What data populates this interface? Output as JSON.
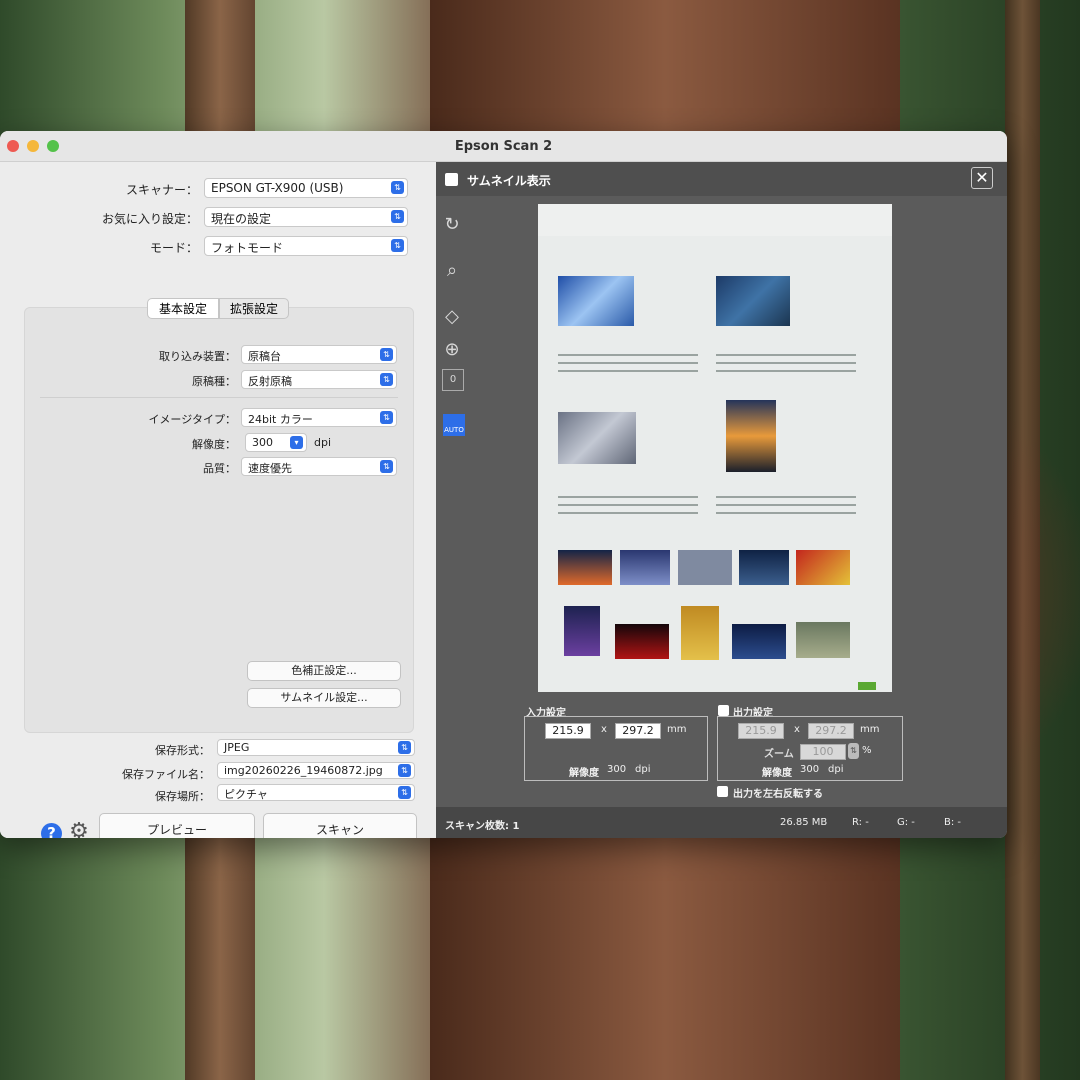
{
  "window": {
    "title": "Epson Scan 2"
  },
  "left": {
    "scanner": {
      "label": "スキャナー：",
      "value": "EPSON GT-X900 (USB)"
    },
    "favorite": {
      "label": "お気に入り設定：",
      "value": "現在の設定"
    },
    "mode": {
      "label": "モード：",
      "value": "フォトモード"
    },
    "tabs": [
      {
        "label": "基本設定"
      },
      {
        "label": "拡張設定"
      }
    ],
    "source": {
      "label": "取り込み装置：",
      "value": "原稿台"
    },
    "doc_type": {
      "label": "原稿種：",
      "value": "反射原稿"
    },
    "image_type": {
      "label": "イメージタイプ：",
      "value": "24bit カラー"
    },
    "resolution": {
      "label": "解像度：",
      "value": "300",
      "unit": "dpi"
    },
    "quality": {
      "label": "品質：",
      "value": "速度優先"
    },
    "color_correction_button": "色補正設定...",
    "thumbnail_settings_button": "サムネイル設定...",
    "save_format": {
      "label": "保存形式：",
      "value": "JPEG"
    },
    "file_name": {
      "label": "保存ファイル名：",
      "value": "img20260226_19460872.jpg"
    },
    "save_location": {
      "label": "保存場所：",
      "value": "ピクチャ"
    },
    "preview_button": "プレビュー",
    "scan_button": "スキャン"
  },
  "right": {
    "thumbnail_checkbox_label": "サムネイル表示",
    "input_settings": {
      "title": "入力設定",
      "width": "215.9",
      "x": "x",
      "height": "297.2",
      "unit": "mm",
      "resolution_label": "解像度",
      "resolution_value": "300",
      "resolution_unit": "dpi"
    },
    "output_settings": {
      "title": "出力設定",
      "width": "215.9",
      "x": "x",
      "height": "297.2",
      "unit": "mm",
      "zoom_label": "ズーム",
      "zoom_value": "100",
      "zoom_unit": "%",
      "resolution_label": "解像度",
      "resolution_value": "300",
      "resolution_unit": "dpi"
    },
    "mirror_label": "出力を左右反転する",
    "status": {
      "scan_count": "スキャン枚数: 1",
      "size": "26.85 MB",
      "r": "R:  -",
      "g": "G:  -",
      "b": "B:  -"
    },
    "tools": {
      "auto_label": "AUTO",
      "count_value": "0"
    }
  },
  "colors": {
    "accent": "#2d6ee8",
    "panel_dark": "#5b5b5b",
    "close_red": "#ee5a52",
    "minimize": "#f5b73a",
    "zoom_green": "#54c24a"
  }
}
